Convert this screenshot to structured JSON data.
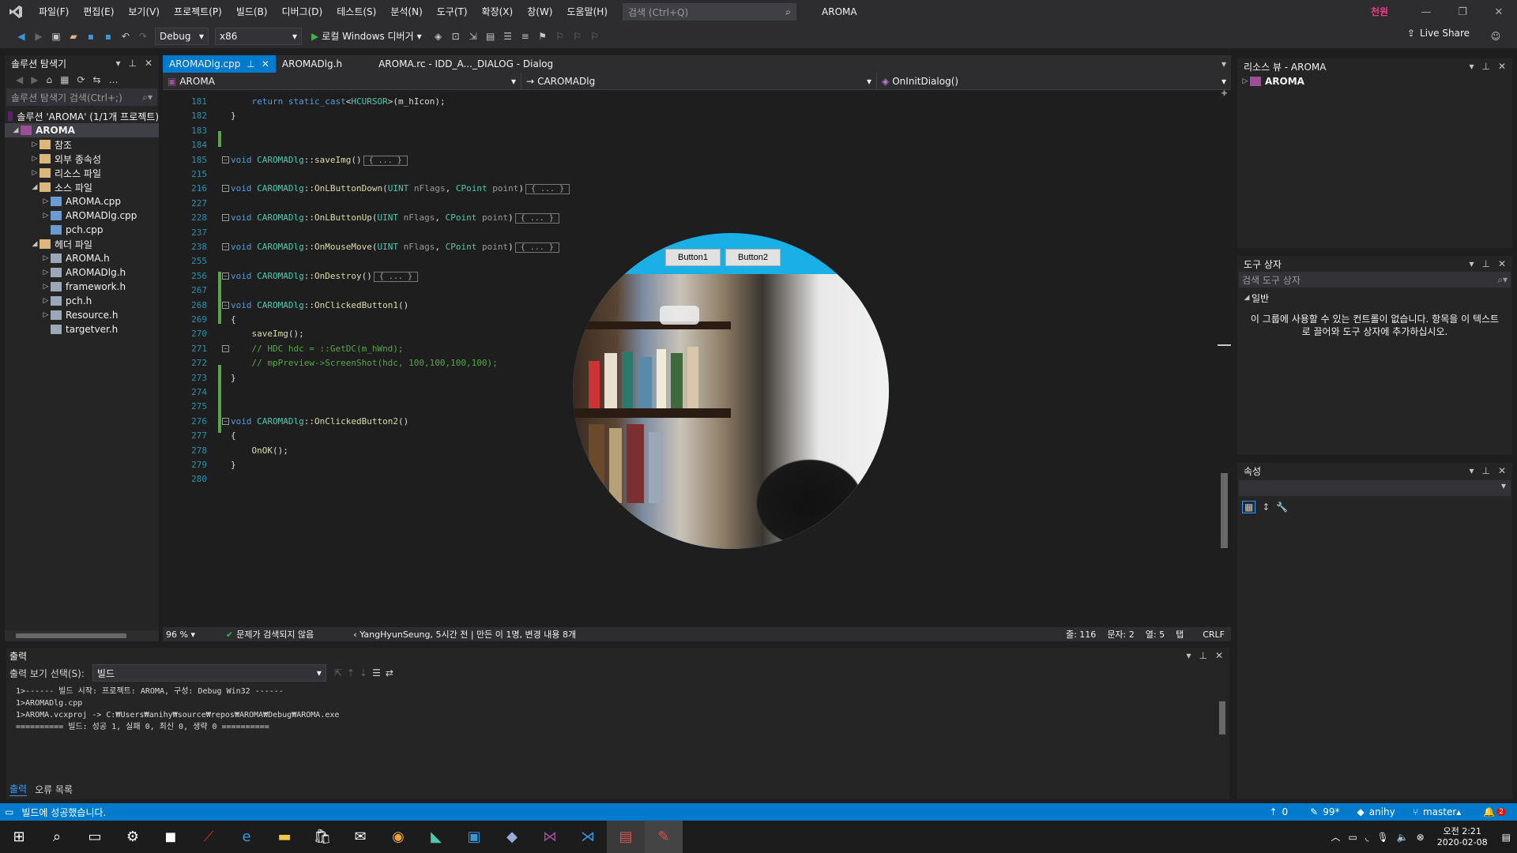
{
  "menu": [
    "파일(F)",
    "편집(E)",
    "보기(V)",
    "프로젝트(P)",
    "빌드(B)",
    "디버그(D)",
    "테스트(S)",
    "분석(N)",
    "도구(T)",
    "확장(X)",
    "창(W)",
    "도움말(H)"
  ],
  "search_placeholder": "검색 (Ctrl+Q)",
  "solution_label": "AROMA",
  "user_initials": "천원",
  "toolbar": {
    "config": "Debug",
    "platform": "x86",
    "run_label": "로컬 Windows 디버거",
    "live_share": "Live Share"
  },
  "solution_explorer": {
    "title": "솔루션 탐색기",
    "search_placeholder": "솔루션 탐색기 검색(Ctrl+;)",
    "solution_row": "솔루션 'AROMA' (1/1개 프로젝트)",
    "project": "AROMA",
    "items": [
      {
        "label": "참조",
        "indent": 2,
        "tri": "▷"
      },
      {
        "label": "외부 종속성",
        "indent": 2,
        "tri": "▷"
      },
      {
        "label": "리소스 파일",
        "indent": 2,
        "tri": "▷"
      },
      {
        "label": "소스 파일",
        "indent": 2,
        "tri": "◢"
      },
      {
        "label": "AROMA.cpp",
        "indent": 3,
        "tri": "▷"
      },
      {
        "label": "AROMADlg.cpp",
        "indent": 3,
        "tri": "▷"
      },
      {
        "label": "pch.cpp",
        "indent": 3,
        "tri": ""
      },
      {
        "label": "헤더 파일",
        "indent": 2,
        "tri": "◢"
      },
      {
        "label": "AROMA.h",
        "indent": 3,
        "tri": "▷"
      },
      {
        "label": "AROMADlg.h",
        "indent": 3,
        "tri": "▷"
      },
      {
        "label": "framework.h",
        "indent": 3,
        "tri": "▷"
      },
      {
        "label": "pch.h",
        "indent": 3,
        "tri": "▷"
      },
      {
        "label": "Resource.h",
        "indent": 3,
        "tri": "▷"
      },
      {
        "label": "targetver.h",
        "indent": 3,
        "tri": ""
      }
    ]
  },
  "tabs": [
    {
      "label": "AROMADlg.cpp",
      "active": true
    },
    {
      "label": "AROMADlg.h",
      "active": false
    },
    {
      "label": "AROMA.rc - IDD_A..._DIALOG - Dialog",
      "active": false
    }
  ],
  "navbar": {
    "project": "AROMA",
    "class": "CAROMADlg",
    "member": "OnInitDialog()"
  },
  "code_lines": [
    {
      "n": "181",
      "html": "    <span class='kw'>return</span> <span class='kw'>static_cast</span>&lt;<span class='ty'>HCURSOR</span>&gt;(m_hIcon);"
    },
    {
      "n": "182",
      "html": "}"
    },
    {
      "n": "183",
      "html": ""
    },
    {
      "n": "184",
      "html": ""
    },
    {
      "n": "185",
      "html": "<span class='kw'>void</span> <span class='ty'>CAROMADlg</span>::<span class='fn'>saveImg</span>()<span class='collapsed'>{ ... }</span>",
      "fold": true
    },
    {
      "n": "215",
      "html": ""
    },
    {
      "n": "216",
      "html": "<span class='kw'>void</span> <span class='ty'>CAROMADlg</span>::<span class='fn'>OnLButtonDown</span>(<span class='ty'>UINT</span> <span class='pr'>nFlags</span>, <span class='ty'>CPoint</span> <span class='pr'>point</span>)<span class='collapsed'>{ ... }</span>",
      "fold": true
    },
    {
      "n": "227",
      "html": ""
    },
    {
      "n": "228",
      "html": "<span class='kw'>void</span> <span class='ty'>CAROMADlg</span>::<span class='fn'>OnLButtonUp</span>(<span class='ty'>UINT</span> <span class='pr'>nFlags</span>, <span class='ty'>CPoint</span> <span class='pr'>point</span>)<span class='collapsed'>{ ... }</span>",
      "fold": true
    },
    {
      "n": "237",
      "html": ""
    },
    {
      "n": "238",
      "html": "<span class='kw'>void</span> <span class='ty'>CAROMADlg</span>::<span class='fn'>OnMouseMove</span>(<span class='ty'>UINT</span> <span class='pr'>nFlags</span>, <span class='ty'>CPoint</span> <span class='pr'>point</span>)<span class='collapsed'>{ ... }</span>",
      "fold": true
    },
    {
      "n": "255",
      "html": ""
    },
    {
      "n": "256",
      "html": "<span class='kw'>void</span> <span class='ty'>CAROMADlg</span>::<span class='fn'>OnDestroy</span>()<span class='collapsed'>{ ... }</span>",
      "fold": true
    },
    {
      "n": "267",
      "html": ""
    },
    {
      "n": "268",
      "html": "<span class='kw'>void</span> <span class='ty'>CAROMADlg</span>::<span class='fn'>OnClickedButton1</span>()",
      "fold": true
    },
    {
      "n": "269",
      "html": "{"
    },
    {
      "n": "270",
      "html": "    <span class='fn'>saveImg</span>();"
    },
    {
      "n": "271",
      "html": "    <span class='cm'>// HDC hdc = ::GetDC(m_hWnd);</span>",
      "fold": true
    },
    {
      "n": "272",
      "html": "    <span class='cm'>// mpPreview-&gt;ScreenShot(hdc, 100,100,100,100);</span>"
    },
    {
      "n": "273",
      "html": "}"
    },
    {
      "n": "274",
      "html": ""
    },
    {
      "n": "275",
      "html": ""
    },
    {
      "n": "276",
      "html": "<span class='kw'>void</span> <span class='ty'>CAROMADlg</span>::<span class='fn'>OnClickedButton2</span>()",
      "fold": true
    },
    {
      "n": "277",
      "html": "{"
    },
    {
      "n": "278",
      "html": "    <span class='fn'>OnOK</span>();"
    },
    {
      "n": "279",
      "html": "}"
    },
    {
      "n": "280",
      "html": ""
    }
  ],
  "editor_status": {
    "zoom": "96 %",
    "issues": "문제가 검색되지 않음",
    "blame": "YangHyunSeung, 5시간 전 | 만든 이 1명, 변경 내용 8개",
    "line": "줄: 116",
    "char": "문자: 2",
    "col": "열: 5",
    "tab": "탭",
    "eol": "CRLF"
  },
  "dialog": {
    "button1": "Button1",
    "button2": "Button2"
  },
  "resource_view": {
    "title": "리소스 뷰 - AROMA",
    "item": "AROMA"
  },
  "toolbox": {
    "title": "도구 상자",
    "search_placeholder": "검색 도구 상자",
    "group": "일반",
    "empty_msg": "이 그룹에 사용할 수 있는 컨트롤이 없습니다. 항목을 이 텍스트로 끌어와 도구 상자에 추가하십시오."
  },
  "properties": {
    "title": "속성"
  },
  "output": {
    "title": "출력",
    "source_label": "출력 보기 선택(S):",
    "source_value": "빌드",
    "lines": [
      "1>------ 빌드 시작: 프로젝트: AROMA, 구성: Debug Win32 ------",
      "1>AROMADlg.cpp",
      "1>AROMA.vcxproj -> C:₩Users₩anihy₩source₩repos₩AROMA₩Debug₩AROMA.exe",
      "========== 빌드: 성공 1, 실패 0, 최신 0, 생략 0 =========="
    ],
    "tab1": "출력",
    "tab2": "오류 목록"
  },
  "statusbar": {
    "message": "빌드에 성공했습니다.",
    "up": "0",
    "pen": "99*",
    "user": "anihy",
    "branch": "master",
    "notif": "2"
  },
  "taskbar": {
    "time": "오전 2:21",
    "date": "2020-02-08"
  }
}
